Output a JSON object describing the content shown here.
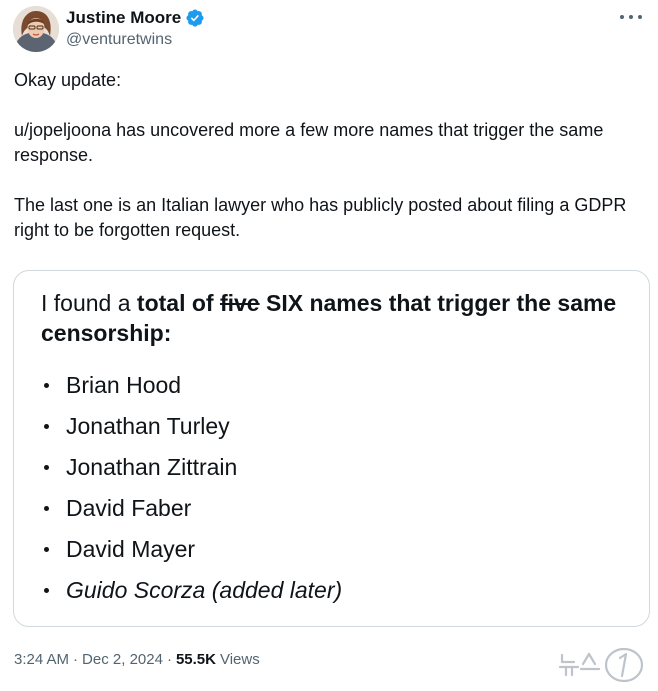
{
  "author": {
    "display_name": "Justine Moore",
    "handle": "@venturetwins",
    "verified": true
  },
  "icons": {
    "more": "more-horizontal-icon",
    "verified": "verified-badge-icon"
  },
  "colors": {
    "verified_blue": "#1d9bf0",
    "text_primary": "#0f1419",
    "text_secondary": "#536471",
    "border": "#cfd9de"
  },
  "tweet": {
    "paragraph_1": "Okay update:",
    "paragraph_2": "u/jopeljoona has uncovered more a few more names that trigger the same response.",
    "paragraph_3": "The last one is an Italian lawyer who has publicly posted about filing a GDPR right to be forgotten request."
  },
  "card": {
    "heading_prefix": "I found a ",
    "heading_bold_1": "total of ",
    "heading_strike": "five",
    "heading_bold_2": " SIX names that trigger the same censorship:",
    "names": [
      "Brian Hood",
      "Jonathan Turley",
      "Jonathan Zittrain",
      "David Faber",
      "David Mayer",
      "Guido Scorza (added later)"
    ]
  },
  "meta": {
    "time": "3:24 AM",
    "separator": "·",
    "date": "Dec 2, 2024",
    "separator_2": "·",
    "views_count": "55.5K",
    "views_label": "Views"
  },
  "watermark": {
    "text": "뉴스1"
  }
}
